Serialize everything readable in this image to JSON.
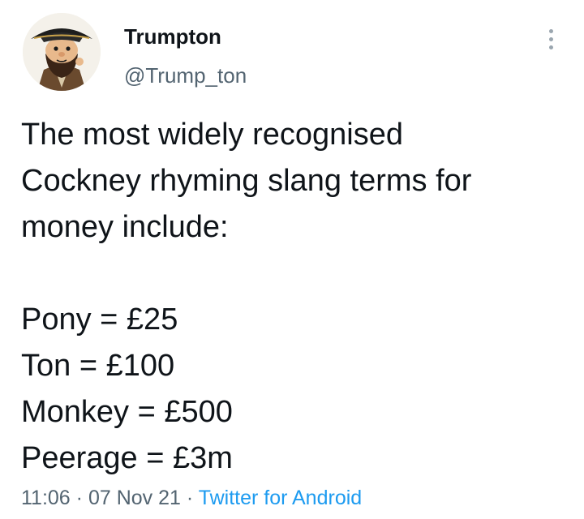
{
  "author": {
    "display_name": "Trumpton",
    "handle": "@Trump_ton",
    "avatar_icon": "pirate-cartoon-avatar"
  },
  "menu": {
    "icon": "more-vertical-icon"
  },
  "tweet": {
    "intro_lines": [
      "The most widely recognised",
      "Cockney rhyming slang terms for",
      "money include:"
    ],
    "terms": [
      "Pony = £25",
      "Ton = £100",
      "Monkey = £500",
      "Peerage = £3m"
    ]
  },
  "meta": {
    "time": "11:06",
    "separator": "·",
    "date": "07 Nov 21",
    "source": "Twitter for Android"
  },
  "colors": {
    "text": "#0f1419",
    "secondary": "#536471",
    "link": "#1d9bf0"
  }
}
